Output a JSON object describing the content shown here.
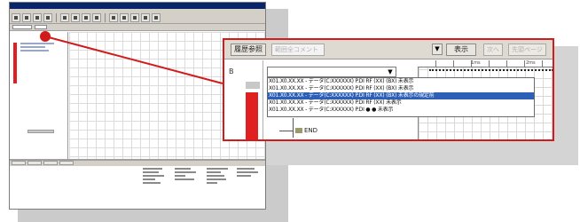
{
  "colors": {
    "accent": "#d21b1b",
    "selection": "#2c5fb5",
    "chrome": "#d4d0c8",
    "titlebar": "#0a246a"
  },
  "main_window": {
    "toolbar_icons": [
      "tool-icon-1",
      "tool-icon-2",
      "tool-icon-3",
      "tool-icon-4",
      "tool-icon-5",
      "tool-icon-6",
      "tool-icon-7",
      "tool-icon-8",
      "tool-icon-9",
      "tool-icon-10",
      "tool-icon-11",
      "tool-icon-12",
      "tool-icon-13"
    ]
  },
  "zoom": {
    "toolbar": {
      "label": "履歴参照",
      "field_placeholder": "範囲全コメント",
      "dropdown_arrow": "▼",
      "button": "表示",
      "disabled_buttons": [
        "次へ",
        "先頭ページ"
      ]
    },
    "side_mark": "B",
    "combo_arrow": "▼",
    "ruler_labels": [
      "1ms",
      "2ms"
    ],
    "list_rows": [
      "X01.X0.XX.XX - データ(C:XXXXXX) P.DI RF (XX) (BX) 未表示",
      "X01.X0.XX.XX - データ(C:XXXXXX) P.DI RF (XX) (BX) 未表示",
      "X01.X0.XX.XX - データ(C:XXXXXX) P.DI RF (XX) (BX) 未表示の規定前",
      "X01.X0.XX.XX - データ(C:XXXXXX) P.DI RF (XX) 未表示",
      "X01.X0.XX.XX - データ(C:XXXXXX) P.DI ● ● 未表示"
    ],
    "selected_index": 2,
    "end_label": "END"
  }
}
